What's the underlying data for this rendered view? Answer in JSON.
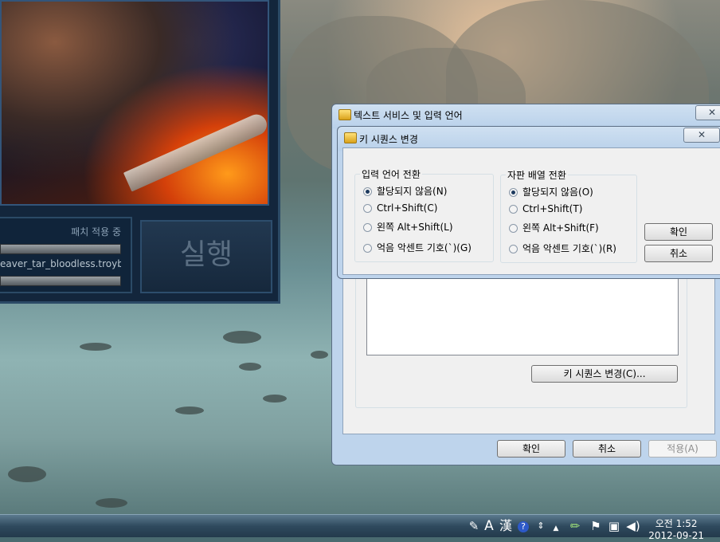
{
  "launcher": {
    "patch_status": "패치 적용 중",
    "patch_file": "eaver_tar_bloodless.troybin",
    "run_button": "실행"
  },
  "text_services_dialog": {
    "title": "텍스트 서비스 및 입력 언어",
    "close": "✕",
    "change_key_sequence_button": "키 시퀀스 변경(C)...",
    "ok": "확인",
    "cancel": "취소",
    "apply": "적용(A)"
  },
  "key_sequence_dialog": {
    "title": "키 시퀀스 변경",
    "close": "✕",
    "input_language_group": {
      "title": "입력 언어 전환",
      "options": [
        "할당되지 않음(N)",
        "Ctrl+Shift(C)",
        "왼쪽 Alt+Shift(L)",
        "억음 악센트 기호(`)(G)"
      ],
      "selected_index": 0
    },
    "keyboard_layout_group": {
      "title": "자판 배열 전환",
      "options": [
        "할당되지 않음(O)",
        "Ctrl+Shift(T)",
        "왼쪽 Alt+Shift(F)",
        "억음 악센트 기호(`)(R)"
      ],
      "selected_index": 0
    },
    "ok": "확인",
    "cancel": "취소"
  },
  "taskbar": {
    "tray_icons": [
      "language-bar-icon",
      "A",
      "漢",
      "help-icon",
      "flag-icon",
      "network-icon",
      "volume-icon"
    ],
    "ime_mode": "A",
    "hanja": "漢",
    "time": "오전 1:52",
    "date": "2012-09-21"
  }
}
